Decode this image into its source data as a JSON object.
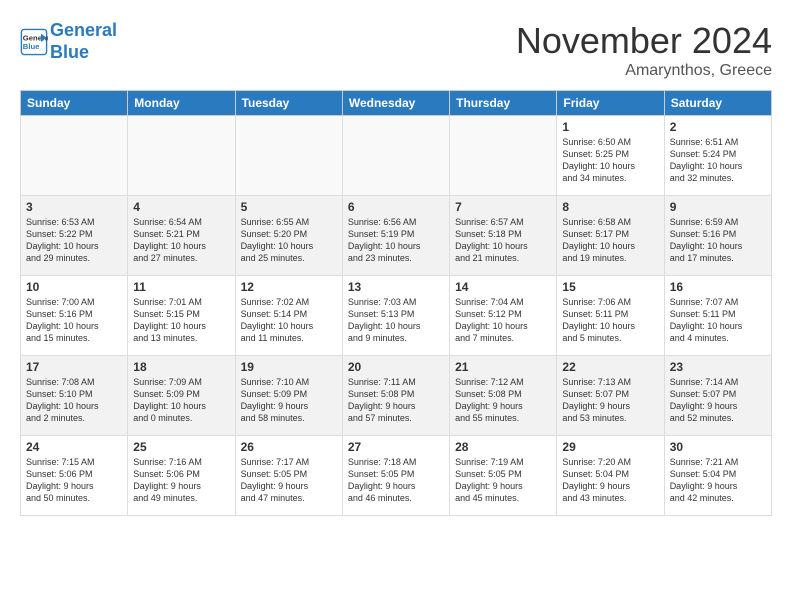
{
  "header": {
    "logo_line1": "General",
    "logo_line2": "Blue",
    "month": "November 2024",
    "location": "Amarynthos, Greece"
  },
  "weekdays": [
    "Sunday",
    "Monday",
    "Tuesday",
    "Wednesday",
    "Thursday",
    "Friday",
    "Saturday"
  ],
  "weeks": [
    [
      {
        "day": "",
        "info": ""
      },
      {
        "day": "",
        "info": ""
      },
      {
        "day": "",
        "info": ""
      },
      {
        "day": "",
        "info": ""
      },
      {
        "day": "",
        "info": ""
      },
      {
        "day": "1",
        "info": "Sunrise: 6:50 AM\nSunset: 5:25 PM\nDaylight: 10 hours\nand 34 minutes."
      },
      {
        "day": "2",
        "info": "Sunrise: 6:51 AM\nSunset: 5:24 PM\nDaylight: 10 hours\nand 32 minutes."
      }
    ],
    [
      {
        "day": "3",
        "info": "Sunrise: 6:53 AM\nSunset: 5:22 PM\nDaylight: 10 hours\nand 29 minutes."
      },
      {
        "day": "4",
        "info": "Sunrise: 6:54 AM\nSunset: 5:21 PM\nDaylight: 10 hours\nand 27 minutes."
      },
      {
        "day": "5",
        "info": "Sunrise: 6:55 AM\nSunset: 5:20 PM\nDaylight: 10 hours\nand 25 minutes."
      },
      {
        "day": "6",
        "info": "Sunrise: 6:56 AM\nSunset: 5:19 PM\nDaylight: 10 hours\nand 23 minutes."
      },
      {
        "day": "7",
        "info": "Sunrise: 6:57 AM\nSunset: 5:18 PM\nDaylight: 10 hours\nand 21 minutes."
      },
      {
        "day": "8",
        "info": "Sunrise: 6:58 AM\nSunset: 5:17 PM\nDaylight: 10 hours\nand 19 minutes."
      },
      {
        "day": "9",
        "info": "Sunrise: 6:59 AM\nSunset: 5:16 PM\nDaylight: 10 hours\nand 17 minutes."
      }
    ],
    [
      {
        "day": "10",
        "info": "Sunrise: 7:00 AM\nSunset: 5:16 PM\nDaylight: 10 hours\nand 15 minutes."
      },
      {
        "day": "11",
        "info": "Sunrise: 7:01 AM\nSunset: 5:15 PM\nDaylight: 10 hours\nand 13 minutes."
      },
      {
        "day": "12",
        "info": "Sunrise: 7:02 AM\nSunset: 5:14 PM\nDaylight: 10 hours\nand 11 minutes."
      },
      {
        "day": "13",
        "info": "Sunrise: 7:03 AM\nSunset: 5:13 PM\nDaylight: 10 hours\nand 9 minutes."
      },
      {
        "day": "14",
        "info": "Sunrise: 7:04 AM\nSunset: 5:12 PM\nDaylight: 10 hours\nand 7 minutes."
      },
      {
        "day": "15",
        "info": "Sunrise: 7:06 AM\nSunset: 5:11 PM\nDaylight: 10 hours\nand 5 minutes."
      },
      {
        "day": "16",
        "info": "Sunrise: 7:07 AM\nSunset: 5:11 PM\nDaylight: 10 hours\nand 4 minutes."
      }
    ],
    [
      {
        "day": "17",
        "info": "Sunrise: 7:08 AM\nSunset: 5:10 PM\nDaylight: 10 hours\nand 2 minutes."
      },
      {
        "day": "18",
        "info": "Sunrise: 7:09 AM\nSunset: 5:09 PM\nDaylight: 10 hours\nand 0 minutes."
      },
      {
        "day": "19",
        "info": "Sunrise: 7:10 AM\nSunset: 5:09 PM\nDaylight: 9 hours\nand 58 minutes."
      },
      {
        "day": "20",
        "info": "Sunrise: 7:11 AM\nSunset: 5:08 PM\nDaylight: 9 hours\nand 57 minutes."
      },
      {
        "day": "21",
        "info": "Sunrise: 7:12 AM\nSunset: 5:08 PM\nDaylight: 9 hours\nand 55 minutes."
      },
      {
        "day": "22",
        "info": "Sunrise: 7:13 AM\nSunset: 5:07 PM\nDaylight: 9 hours\nand 53 minutes."
      },
      {
        "day": "23",
        "info": "Sunrise: 7:14 AM\nSunset: 5:07 PM\nDaylight: 9 hours\nand 52 minutes."
      }
    ],
    [
      {
        "day": "24",
        "info": "Sunrise: 7:15 AM\nSunset: 5:06 PM\nDaylight: 9 hours\nand 50 minutes."
      },
      {
        "day": "25",
        "info": "Sunrise: 7:16 AM\nSunset: 5:06 PM\nDaylight: 9 hours\nand 49 minutes."
      },
      {
        "day": "26",
        "info": "Sunrise: 7:17 AM\nSunset: 5:05 PM\nDaylight: 9 hours\nand 47 minutes."
      },
      {
        "day": "27",
        "info": "Sunrise: 7:18 AM\nSunset: 5:05 PM\nDaylight: 9 hours\nand 46 minutes."
      },
      {
        "day": "28",
        "info": "Sunrise: 7:19 AM\nSunset: 5:05 PM\nDaylight: 9 hours\nand 45 minutes."
      },
      {
        "day": "29",
        "info": "Sunrise: 7:20 AM\nSunset: 5:04 PM\nDaylight: 9 hours\nand 43 minutes."
      },
      {
        "day": "30",
        "info": "Sunrise: 7:21 AM\nSunset: 5:04 PM\nDaylight: 9 hours\nand 42 minutes."
      }
    ]
  ]
}
